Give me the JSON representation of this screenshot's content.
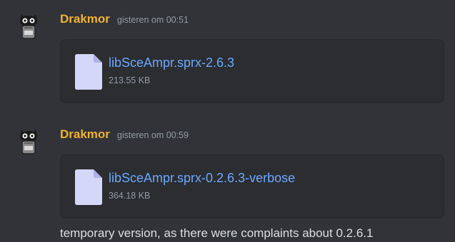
{
  "messages": [
    {
      "author": "Drakmor",
      "timestamp": "gisteren om 00:51",
      "attachment": {
        "name": "libSceAmpr.sprx-2.6.3",
        "size": "213.55 KB"
      }
    },
    {
      "author": "Drakmor",
      "timestamp": "gisteren om 00:59",
      "attachment": {
        "name": "libSceAmpr.sprx-0.2.6.3-verbose",
        "size": "364.18 KB"
      },
      "text": "temporary version, as there were complaints about 0.2.6.1"
    }
  ],
  "colors": {
    "background": "#313338",
    "username": "#f0b232",
    "link": "#6ba8ff",
    "muted": "#949ba4",
    "attachment_bg": "#2b2d31"
  },
  "icons": [
    "avatar-cat-icon",
    "file-icon"
  ]
}
